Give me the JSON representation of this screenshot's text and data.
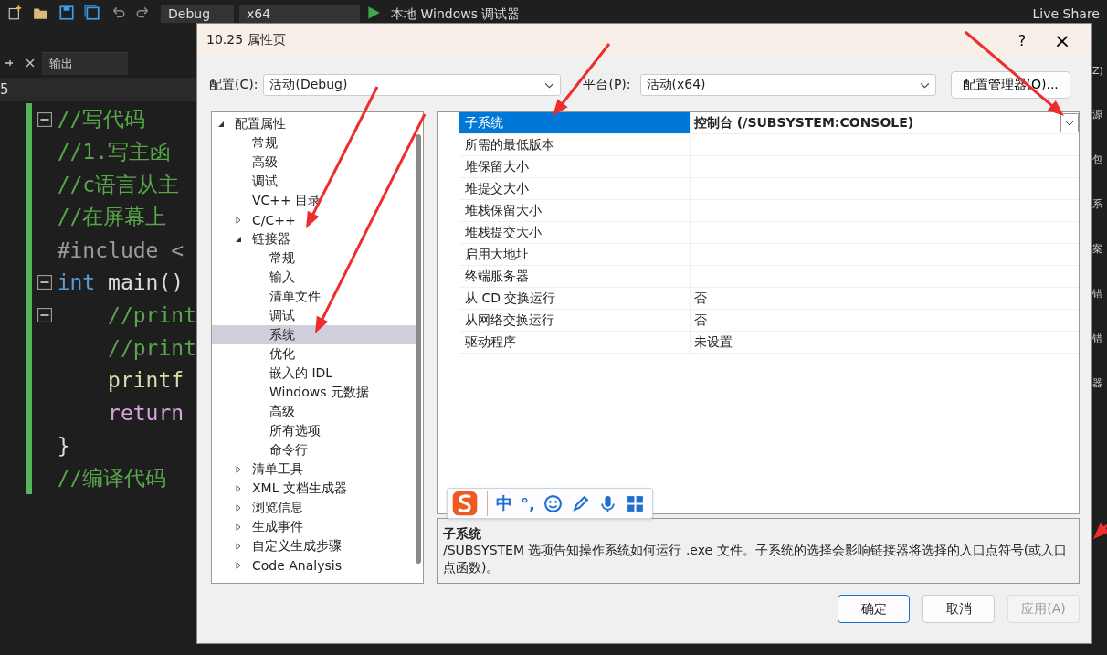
{
  "toolbar": {
    "config": "Debug",
    "platform": "x64",
    "debugger": "本地 Windows 调试器",
    "share": "Live Share"
  },
  "panel_tab": {
    "label": "输出",
    "selected": true
  },
  "line_info": "5",
  "code": [
    {
      "fold": true,
      "parts": [
        {
          "text": "//写代码",
          "kind": "comment"
        }
      ]
    },
    {
      "fold": false,
      "parts": [
        {
          "text": "//1.写主函",
          "kind": "comment"
        }
      ]
    },
    {
      "fold": false,
      "parts": [
        {
          "text": "//c语言从主",
          "kind": "comment"
        }
      ]
    },
    {
      "fold": false,
      "parts": [
        {
          "text": "//在屏幕上",
          "kind": "comment"
        }
      ]
    },
    {
      "fold": false,
      "parts": [
        {
          "text": "#include <",
          "kind": "include"
        }
      ]
    },
    {
      "fold": true,
      "parts": [
        {
          "text": "int",
          "kind": "keyword"
        },
        {
          "text": " main()",
          "kind": "plain"
        }
      ]
    },
    {
      "fold": true,
      "parts": [
        {
          "text": "    //print",
          "kind": "comment"
        }
      ]
    },
    {
      "fold": false,
      "parts": [
        {
          "text": "    //print",
          "kind": "comment"
        }
      ]
    },
    {
      "fold": false,
      "parts": [
        {
          "text": "    printf",
          "kind": "function"
        }
      ]
    },
    {
      "fold": false,
      "parts": [
        {
          "text": "    return",
          "kind": "control"
        }
      ]
    },
    {
      "fold": false,
      "parts": [
        {
          "text": "}",
          "kind": "plain"
        }
      ]
    },
    {
      "fold": false,
      "parts": [
        {
          "text": "//编译代码",
          "kind": "comment"
        }
      ]
    }
  ],
  "right_edge": [
    "Z)",
    "源",
    "包",
    "系",
    "案",
    "错",
    "错",
    "器"
  ],
  "dialog": {
    "title": "10.25 属性页",
    "help": "?",
    "close": "×",
    "config_label": "配置(C):",
    "config_value": "活动(Debug)",
    "platform_label": "平台(P):",
    "platform_value": "活动(x64)",
    "manager_button": "配置管理器(O)...",
    "tree": [
      {
        "label": "配置属性",
        "expanded": true,
        "selected": false,
        "children": [
          {
            "label": "常规",
            "selected": false
          },
          {
            "label": "高级",
            "selected": false
          },
          {
            "label": "调试",
            "selected": false
          },
          {
            "label": "VC++ 目录",
            "selected": false
          },
          {
            "label": "C/C++",
            "expanded": false,
            "selected": false
          },
          {
            "label": "链接器",
            "expanded": true,
            "selected": false,
            "children": [
              {
                "label": "常规",
                "selected": false
              },
              {
                "label": "输入",
                "selected": false
              },
              {
                "label": "清单文件",
                "selected": false
              },
              {
                "label": "调试",
                "selected": false
              },
              {
                "label": "系统",
                "selected": true
              },
              {
                "label": "优化",
                "selected": false
              },
              {
                "label": "嵌入的 IDL",
                "selected": false
              },
              {
                "label": "Windows 元数据",
                "selected": false
              },
              {
                "label": "高级",
                "selected": false
              },
              {
                "label": "所有选项",
                "selected": false
              },
              {
                "label": "命令行",
                "selected": false
              }
            ]
          },
          {
            "label": "清单工具",
            "expanded": false,
            "selected": false
          },
          {
            "label": "XML 文档生成器",
            "expanded": false,
            "selected": false
          },
          {
            "label": "浏览信息",
            "expanded": false,
            "selected": false
          },
          {
            "label": "生成事件",
            "expanded": false,
            "selected": false
          },
          {
            "label": "自定义生成步骤",
            "expanded": false,
            "selected": false
          },
          {
            "label": "Code Analysis",
            "expanded": false,
            "selected": false
          }
        ]
      }
    ],
    "properties": [
      {
        "name": "子系统",
        "value": "控制台 (/SUBSYSTEM:CONSOLE)",
        "selected": true
      },
      {
        "name": "所需的最低版本",
        "selected": false
      },
      {
        "name": "堆保留大小",
        "selected": false
      },
      {
        "name": "堆提交大小",
        "selected": false
      },
      {
        "name": "堆栈保留大小",
        "selected": false
      },
      {
        "name": "堆栈提交大小",
        "selected": false
      },
      {
        "name": "启用大地址",
        "selected": false
      },
      {
        "name": "终端服务器",
        "selected": false
      },
      {
        "name": "从 CD 交换运行",
        "value": "否",
        "selected": false
      },
      {
        "name": "从网络交换运行",
        "value": "否",
        "selected": false
      },
      {
        "name": "驱动程序",
        "value": "未设置",
        "selected": false
      }
    ],
    "description": {
      "title": "子系统",
      "text": "/SUBSYSTEM 选项告知操作系统如何运行 .exe 文件。子系统的选择会影响链接器将选择的入口点符号(或入口点函数)。"
    },
    "buttons": [
      {
        "label": "确定",
        "kind": "default",
        "disabled": false
      },
      {
        "label": "取消",
        "kind": "normal",
        "disabled": false
      },
      {
        "label": "应用(A)",
        "kind": "normal",
        "disabled": true
      }
    ]
  },
  "ime": {
    "mode": "中",
    "punct": "°,"
  }
}
